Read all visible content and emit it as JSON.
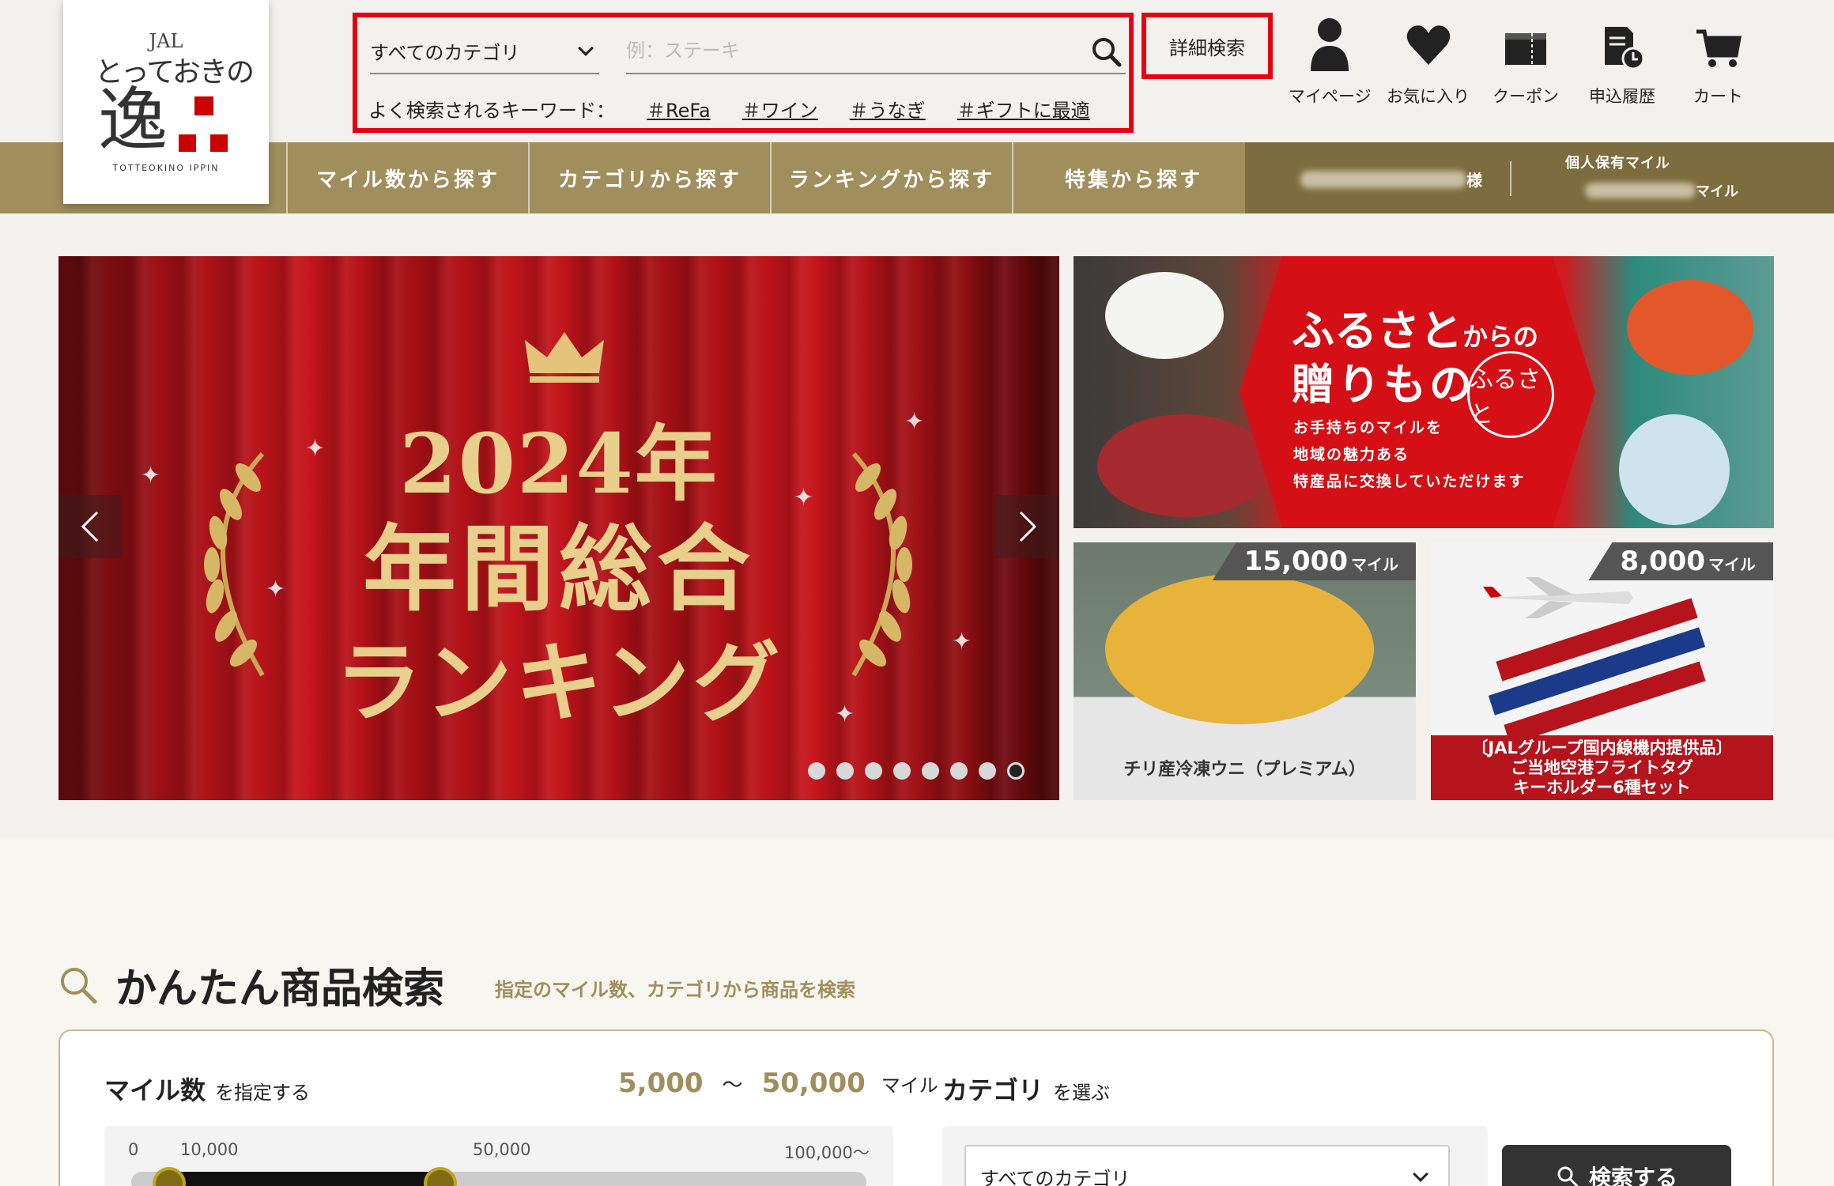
{
  "logo": {
    "jal": "JAL",
    "script": "とっておきの",
    "kanji": "逸",
    "english": "TOTTEOKINO IPPIN"
  },
  "search": {
    "category_selected": "すべてのカテゴリ",
    "placeholder": "例：ステーキ",
    "value": "",
    "popular_label": "よく検索されるキーワード：",
    "tags": [
      "＃ReFa",
      "＃ワイン",
      "＃うなぎ",
      "＃ギフトに最適"
    ],
    "advanced_label": "詳細検索"
  },
  "header_nav": [
    {
      "label": "マイページ",
      "icon": "person-icon"
    },
    {
      "label": "お気に入り",
      "icon": "heart-icon"
    },
    {
      "label": "クーポン",
      "icon": "coupon-icon"
    },
    {
      "label": "申込履歴",
      "icon": "history-icon"
    },
    {
      "label": "カート",
      "icon": "cart-icon"
    }
  ],
  "main_nav": [
    {
      "label": "マイル数から探す"
    },
    {
      "label": "カテゴリから探す"
    },
    {
      "label": "ランキングから探す"
    },
    {
      "label": "特集から探す"
    }
  ],
  "user": {
    "name_suffix": "様",
    "miles_label": "個人保有マイル",
    "miles_unit": "マイル"
  },
  "hero": {
    "year": "2024年",
    "title": "年間総合",
    "subtitle": "ランキング",
    "slide_count": 8,
    "active_slide": 7
  },
  "furusato": {
    "title_a": "ふるさと",
    "title_small": "からの",
    "title_b": "贈りもの",
    "description_lines": [
      "お手持ちのマイルを",
      "地域の魅力ある",
      "特産品に交換していただけます"
    ],
    "seal": "ふるさと"
  },
  "products": [
    {
      "price": "15,000",
      "unit": "マイル",
      "caption": "チリ産冷凍ウニ（プレミアム）"
    },
    {
      "price": "8,000",
      "unit": "マイル",
      "caption_lines": [
        "〔JALグループ国内線機内提供品〕",
        "ご当地空港フライトタグ",
        "キーホルダー6種セット"
      ]
    }
  ],
  "quick_search": {
    "title": "かんたん商品検索",
    "subtitle": "指定のマイル数、カテゴリから商品を検索",
    "miles_heading": "マイル数",
    "miles_heading_suffix": "を指定する",
    "range_min": "5,000",
    "range_sep": "～",
    "range_max": "50,000",
    "range_unit": "マイル",
    "ticks": [
      "0",
      "10,000",
      "50,000",
      "100,000～"
    ],
    "slider_low": 10000,
    "slider_high": 50000,
    "slider_max": 100000,
    "category_heading": "カテゴリ",
    "category_heading_suffix": "を選ぶ",
    "category_selected": "すべてのカテゴリ",
    "search_button": "検索する"
  },
  "colors": {
    "accent_red": "#e60012",
    "gold": "#a08e5c",
    "gold_dark": "#7d6c3d"
  }
}
